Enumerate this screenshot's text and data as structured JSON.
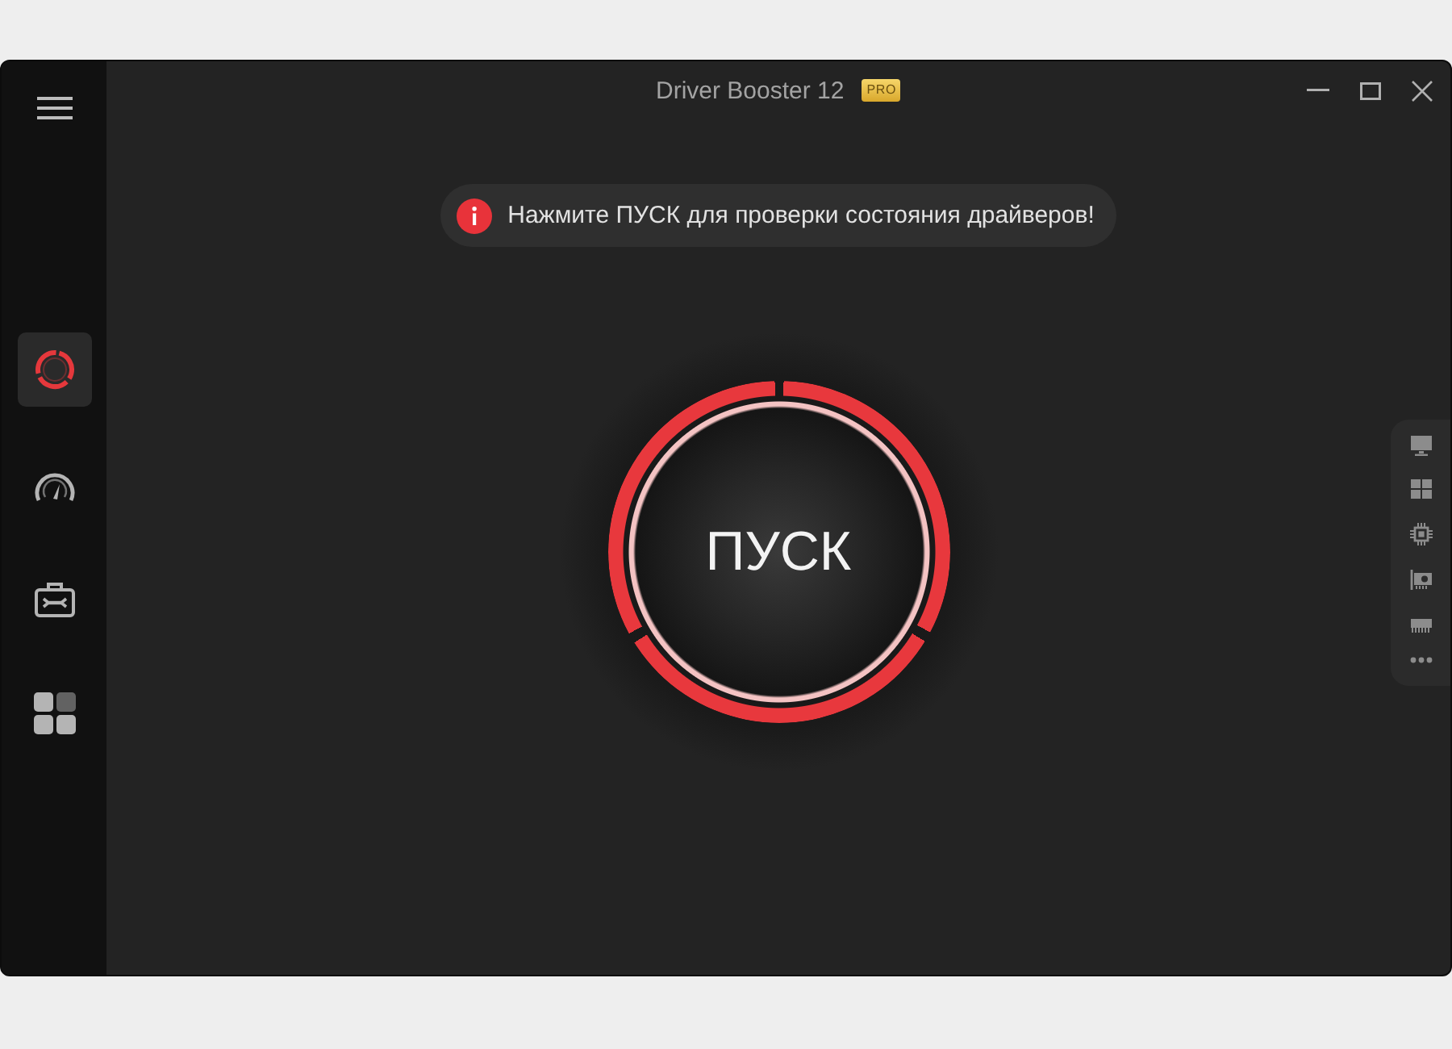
{
  "window": {
    "title": "Driver Booster 12",
    "badge": "PRO"
  },
  "sidebar": {
    "items": [
      {
        "kind": "scan",
        "selected": true
      },
      {
        "kind": "gauge",
        "selected": false
      },
      {
        "kind": "toolbox",
        "selected": false
      },
      {
        "kind": "tiles",
        "selected": false
      }
    ]
  },
  "notice": {
    "text": "Нажмите ПУСК для проверки состояния драйверов!"
  },
  "scan_button": {
    "label": "ПУСК"
  }
}
